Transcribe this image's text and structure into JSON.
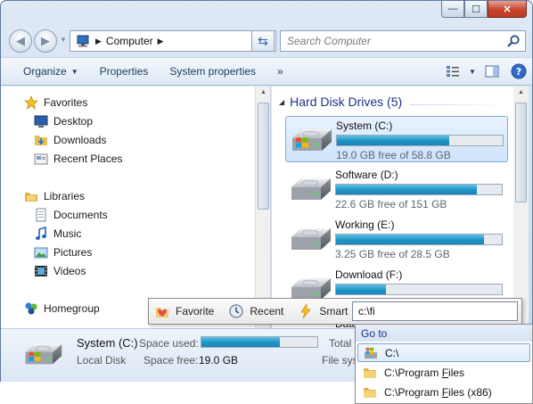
{
  "window": {
    "caption_buttons": {
      "minimize": "—",
      "maximize": "☐",
      "close": "✕"
    }
  },
  "address_bar": {
    "crumb": "Computer",
    "search_placeholder": "Search Computer"
  },
  "toolbar": {
    "organize": "Organize",
    "properties": "Properties",
    "system_properties": "System properties",
    "more": "»"
  },
  "sidebar": {
    "favorites": {
      "label": "Favorites",
      "items": [
        "Desktop",
        "Downloads",
        "Recent Places"
      ]
    },
    "libraries": {
      "label": "Libraries",
      "items": [
        "Documents",
        "Music",
        "Pictures",
        "Videos"
      ]
    },
    "homegroup": {
      "label": "Homegroup"
    }
  },
  "content": {
    "group_title": "Hard Disk Drives (5)",
    "drives": [
      {
        "name": "System (C:)",
        "free_text": "19.0 GB free of 58.8 GB",
        "used_fraction": 0.68,
        "selected": true
      },
      {
        "name": "Software (D:)",
        "free_text": "22.6 GB free of 151 GB",
        "used_fraction": 0.85,
        "selected": false
      },
      {
        "name": "Working (E:)",
        "free_text": "3.25 GB free of 28.5 GB",
        "used_fraction": 0.89,
        "selected": false
      },
      {
        "name": "Download (F:)",
        "free_text": "",
        "used_fraction": 0.3,
        "selected": false
      }
    ],
    "partial_label": "Data"
  },
  "details": {
    "name": "System (C:)",
    "type": "Local Disk",
    "space_used_label": "Space used:",
    "space_used_fraction": 0.68,
    "space_free_label": "Space free:",
    "space_free_value": "19.0 GB",
    "total_label": "Total",
    "filesystem_label": "File syst"
  },
  "quickbar": {
    "favorite": "Favorite",
    "recent": "Recent",
    "smart": "Smart",
    "input_value": "c:\\fi"
  },
  "goto_menu": {
    "header": "Go to",
    "items": [
      {
        "prefix": "C:\\",
        "underlined": "",
        "suffix": ""
      },
      {
        "prefix": "C:\\Program ",
        "underlined": "F",
        "suffix": "iles"
      },
      {
        "prefix": "C:\\Program ",
        "underlined": "F",
        "suffix": "iles (x86)"
      }
    ]
  },
  "colors": {
    "accent": "#1e3287",
    "bar_fill": "#1d93c4",
    "selection": "#cfe3fb"
  }
}
